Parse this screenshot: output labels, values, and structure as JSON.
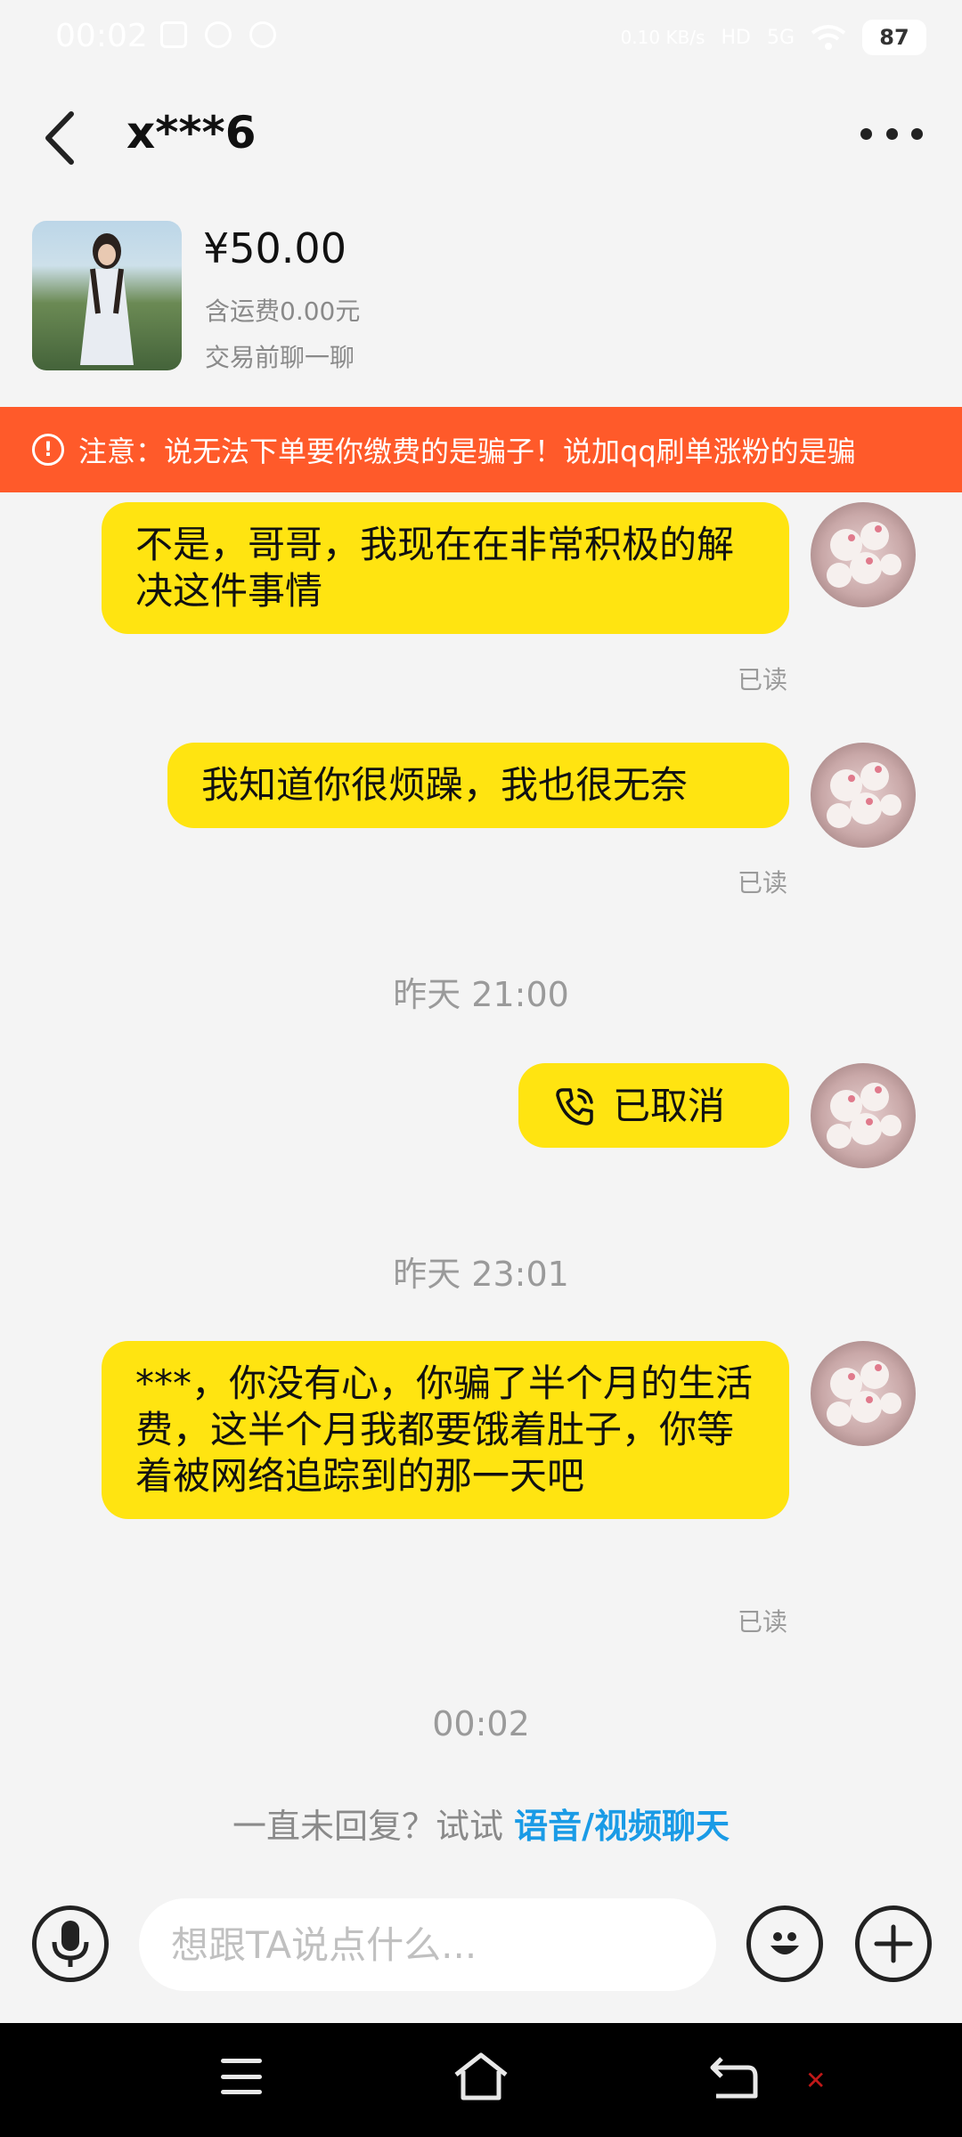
{
  "status_bar": {
    "time": "00:02",
    "signal": "5G",
    "speed": "0.10\nKB/s",
    "hd": "HD",
    "battery": "87"
  },
  "header": {
    "title": "x***6",
    "back_icon": "chevron-left-icon",
    "more_icon": "more-dots-icon"
  },
  "product": {
    "price": "¥50.00",
    "shipping": "含运费0.00元",
    "hint": "交易前聊一聊"
  },
  "warning": {
    "icon": "alert-circle-icon",
    "text": "注意：说无法下单要你缴费的是骗子！说加qq刷单涨粉的是骗"
  },
  "messages": [
    {
      "text": "不是，哥哥，我现在在非常积极的解决这件事情",
      "status": "已读"
    },
    {
      "text": "我知道你很烦躁，我也很无奈",
      "status": "已读"
    },
    {
      "timestamp": "昨天 21:00"
    },
    {
      "call_text": "已取消",
      "call_icon": "phone-call-icon"
    },
    {
      "timestamp": "昨天 23:01"
    },
    {
      "text": "***，你没有心，你骗了半个月的生活费，这半个月我都要饿着肚子，你等着被网络追踪到的那一天吧",
      "status": "已读"
    },
    {
      "timestamp": "00:02"
    }
  ],
  "suggest": {
    "prefix": "一直未回复？试试 ",
    "link": "语音/视频聊天"
  },
  "input_bar": {
    "placeholder": "想跟TA说点什么...",
    "mic_icon": "microphone-icon",
    "emoji_icon": "emoji-icon",
    "plus_icon": "plus-icon"
  },
  "colors": {
    "bubble": "#ffe411",
    "warning": "#ff5a2a",
    "link": "#1a9be6",
    "background": "#f4f4f4"
  }
}
